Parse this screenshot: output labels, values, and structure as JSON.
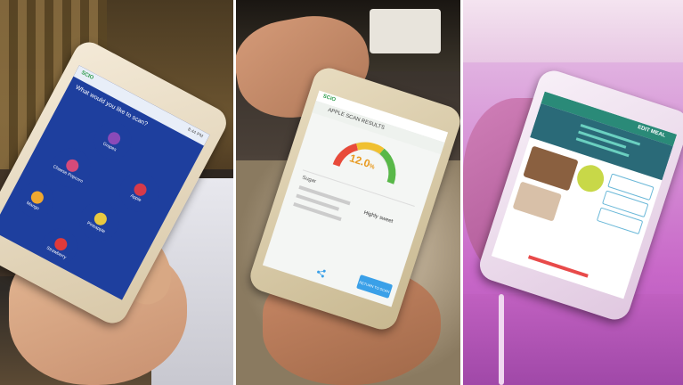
{
  "panels": [
    {
      "scene": "person holding phone showing food scanning menu",
      "phone": {
        "brand_mark": "SCIO",
        "status_time": "8:44 PM",
        "prompt": "What would you like to scan?",
        "menu_items": [
          "Grapes",
          "Apple",
          "Cheese Popcorn",
          "Pineapple",
          "Mango",
          "Strawberry"
        ],
        "colors": {
          "screen": "#1e3f9e",
          "bubble": "#1a3690",
          "apple": "#d63a4a",
          "grapes": "#8a4ab8"
        }
      }
    },
    {
      "scene": "person holding phone showing apple scan results",
      "phone": {
        "brand_mark": "SCiO",
        "result_title": "APPLE SCAN RESULTS",
        "gauge_value": "12.0",
        "gauge_unit": "%",
        "gauge_label": "Sugar",
        "detail_label": "Highly sweet",
        "action_label": "RETURN TO SCAN",
        "colors": {
          "gauge_low": "#e84a3a",
          "gauge_mid": "#f0c030",
          "gauge_high": "#58b848",
          "value": "#e89a20"
        }
      }
    },
    {
      "scene": "phone on pink display stand showing meal editor",
      "phone": {
        "header": "EDIT MEAL",
        "colors": {
          "header": "#2a8a78",
          "background": "#ffffff"
        }
      }
    }
  ]
}
